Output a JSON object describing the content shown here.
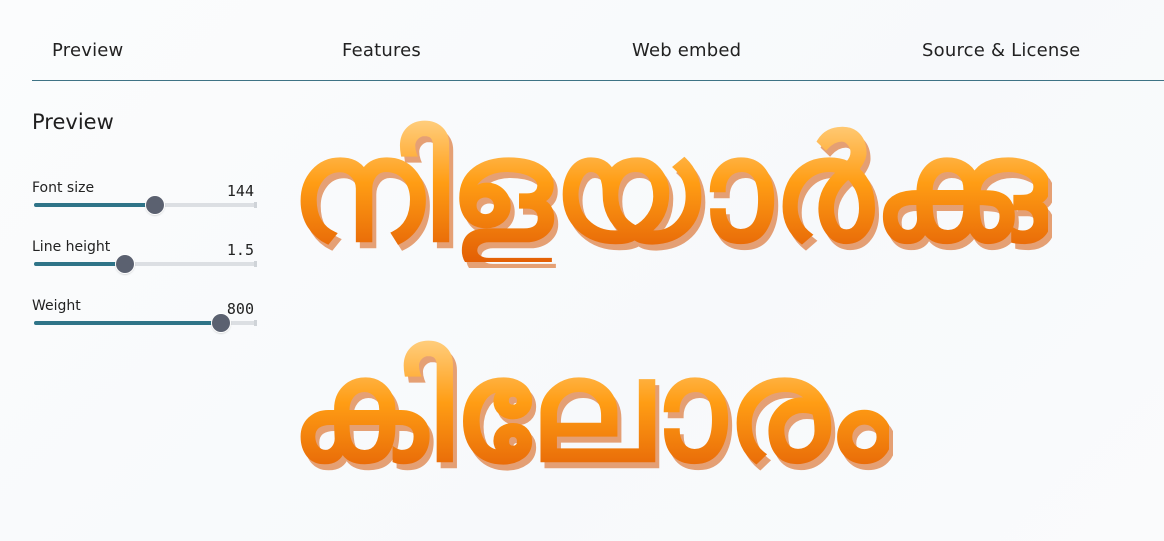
{
  "nav": {
    "items": [
      {
        "label": "Preview"
      },
      {
        "label": "Features"
      },
      {
        "label": "Web embed"
      },
      {
        "label": "Source & License"
      }
    ]
  },
  "sidebar": {
    "title": "Preview",
    "controls": [
      {
        "label": "Font size",
        "value": "144",
        "fraction": 0.545
      },
      {
        "label": "Line height",
        "value": "1.5",
        "fraction": 0.41
      },
      {
        "label": "Weight",
        "value": "800",
        "fraction": 0.842
      }
    ]
  },
  "preview": {
    "lines": [
      "നിളയാർക്കു",
      "കിലോരം"
    ]
  },
  "colors": {
    "accent": "#2f7488",
    "divider": "#3e7385",
    "thumb": "#5b6170",
    "text_gradient_light": "#ffcf80",
    "text_gradient_mid": "#ff9d14",
    "text_gradient_dark": "#e35f05"
  }
}
